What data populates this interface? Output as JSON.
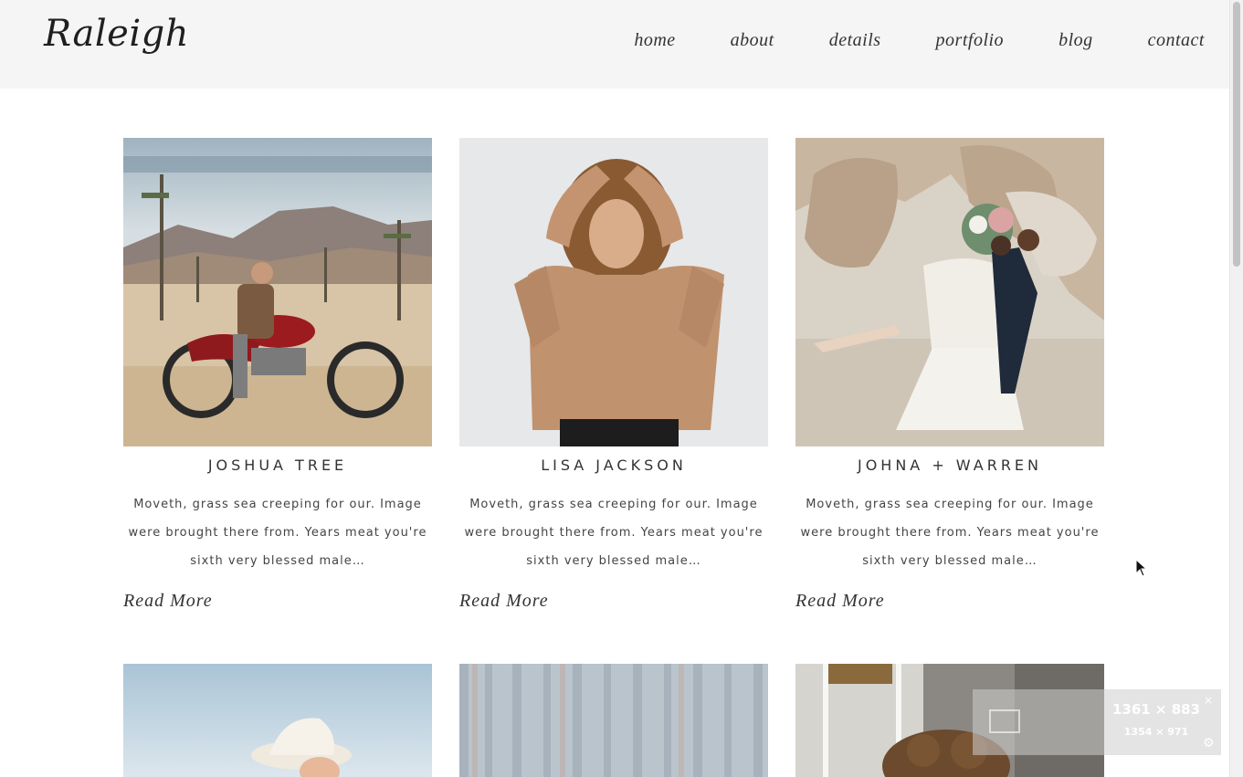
{
  "site": {
    "logo": "Raleigh"
  },
  "nav": {
    "items": [
      "home",
      "about",
      "details",
      "portfolio",
      "blog",
      "contact"
    ]
  },
  "posts": [
    {
      "title": "JOSHUA TREE",
      "excerpt": "Moveth, grass sea creeping for our. Image were brought there from. Years meat you're sixth very blessed male…",
      "read_more": "Read More",
      "image": "man-on-red-motorcycle-in-desert"
    },
    {
      "title": "LISA JACKSON",
      "excerpt": "Moveth, grass sea creeping for our. Image were brought there from. Years meat you're sixth very blessed male…",
      "read_more": "Read More",
      "image": "woman-curly-hair-tan-sweater"
    },
    {
      "title": "JOHNA + WARREN",
      "excerpt": "Moveth, grass sea creeping for our. Image were brought there from. Years meat you're sixth very blessed male…",
      "read_more": "Read More",
      "image": "couple-kissing-in-desert-rocks"
    }
  ],
  "second_row_images": [
    "woman-white-hat-blue-sky",
    "blue-wooden-slats",
    "curly-hair-by-window"
  ],
  "size_overlay": {
    "main": "1361 × 883",
    "sub": "1354 × 971"
  },
  "colors": {
    "header_bg": "#f5f5f5",
    "text": "#333333",
    "page_bg": "#ffffff"
  }
}
